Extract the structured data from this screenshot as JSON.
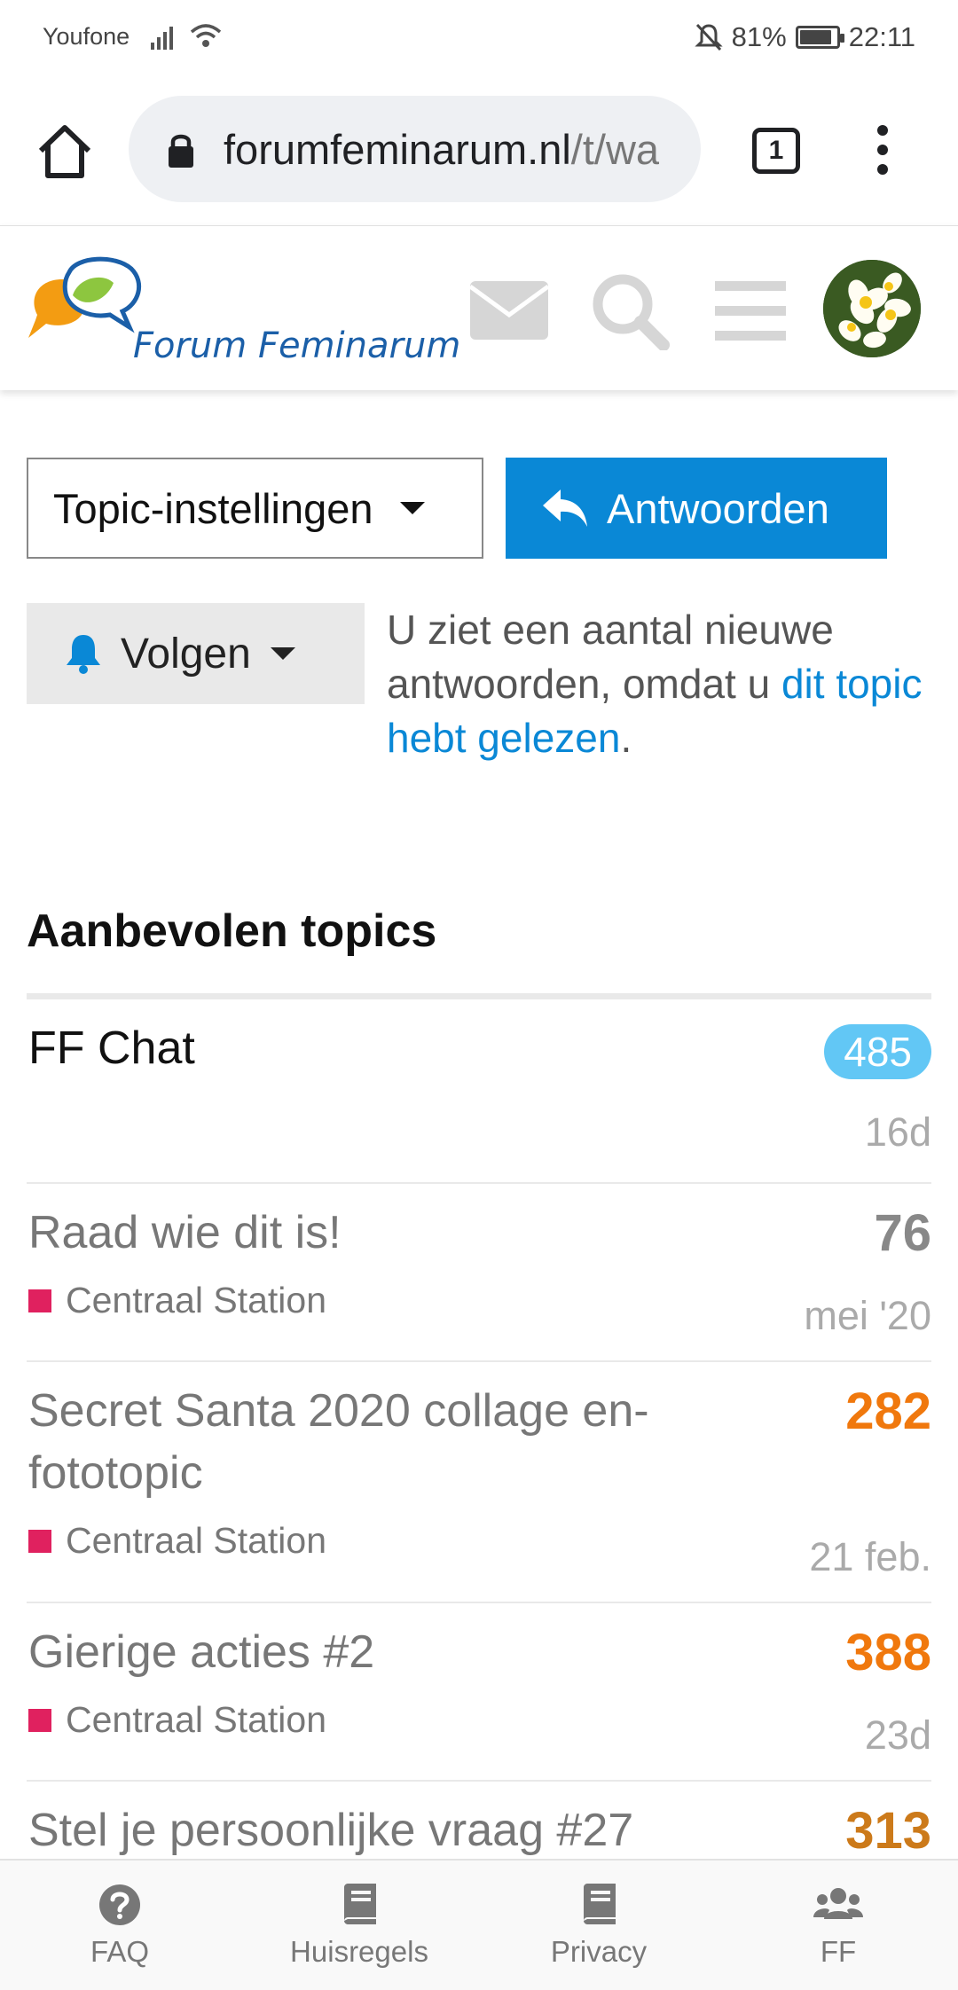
{
  "status": {
    "carrier": "Youfone",
    "battery": "81%",
    "battery_level": 0.81,
    "time": "22:11",
    "icons": [
      "signal-icon",
      "wifi-icon",
      "mute-bell-icon",
      "battery-icon"
    ]
  },
  "browser": {
    "url_main": "forumfeminarum.nl",
    "url_path": "/t/wa",
    "tab_count": "1"
  },
  "header": {
    "site_name": "Forum Feminarum",
    "icons": [
      "envelope-icon",
      "search-icon",
      "hamburger-menu-icon",
      "avatar"
    ]
  },
  "topic_controls": {
    "settings_label": "Topic-instellingen",
    "reply_label": "Antwoorden",
    "follow_label": "Volgen",
    "note_prefix": "U ziet een aantal nieuwe antwoorden, omdat u ",
    "note_link": "dit topic hebt gelezen",
    "note_suffix": "."
  },
  "recommended": {
    "title": "Aanbevolen topics",
    "topics": [
      {
        "title": "FF Chat",
        "category": "",
        "count": "485",
        "date": "16d",
        "unread": true
      },
      {
        "title": "Raad wie dit is!",
        "category": "Centraal Station",
        "count": "76",
        "date": "mei '20",
        "unread": false
      },
      {
        "title": "Secret Santa 2020 collage en-fototopic",
        "category": "Centraal Station",
        "count": "282",
        "date": "21 feb.",
        "unread": false
      },
      {
        "title": "Gierige acties #2",
        "category": "Centraal Station",
        "count": "388",
        "date": "23d",
        "unread": false
      },
      {
        "title": "Stel je persoonlijke vraag #27",
        "category": "",
        "count": "313",
        "date": "",
        "unread": false
      }
    ],
    "category_color": "#e0215f"
  },
  "bottom_nav": {
    "items": [
      {
        "label": "FAQ",
        "icon": "question-circle-icon"
      },
      {
        "label": "Huisregels",
        "icon": "book-icon"
      },
      {
        "label": "Privacy",
        "icon": "book-icon"
      },
      {
        "label": "FF",
        "icon": "users-icon"
      }
    ]
  },
  "colors": {
    "accent": "#0a88d6",
    "unread_badge": "#62c7f5",
    "hot_count": "#f0780d"
  }
}
